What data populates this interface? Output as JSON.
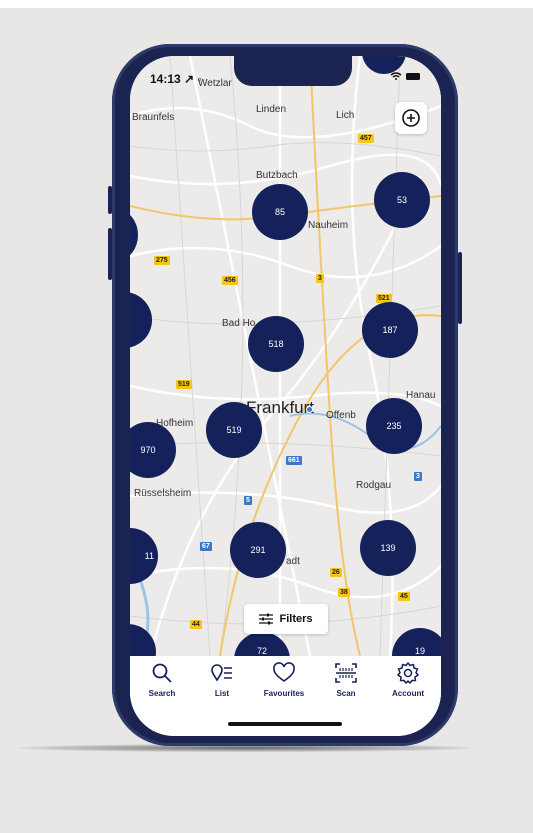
{
  "status": {
    "time": "14:13",
    "nav_glyph": "↗",
    "signal_glyph": "◦",
    "icons_text": "📶 ▬"
  },
  "map": {
    "labels": {
      "wetzlar": "Wetzlar",
      "braunfels": "Braunfels",
      "linden": "Linden",
      "lich": "Lich",
      "butzbach": "Butzbach",
      "nauheim": "Nauheim",
      "bad_homburg": "Bad Ho",
      "frankfurt": "Frankfurt",
      "offenbach": "Offenb",
      "hanau": "Hanau",
      "hofheim": "Hofheim",
      "ruesselsheim": "Rüsselsheim",
      "rodgau": "Rodgau",
      "darmstadt": "adt"
    },
    "road_badges": {
      "b457": "457",
      "b275": "275",
      "b456": "456",
      "b3a": "3",
      "b521": "521",
      "b519": "519",
      "b661": "661",
      "b5": "5",
      "b3b": "3",
      "b67": "67",
      "b26": "26",
      "b38": "38",
      "b45": "45",
      "b44": "44"
    },
    "clusters": {
      "c85": "85",
      "c53": "53",
      "c518": "518",
      "c187": "187",
      "c519": "519",
      "c235": "235",
      "c970": "970",
      "c291": "291",
      "c139": "139",
      "c11": "11",
      "c72": "72",
      "c19": "19"
    }
  },
  "zoom_button_icon": "plus-circle-icon",
  "filters": {
    "label": "Filters",
    "icon": "sliders-icon"
  },
  "tabbar": {
    "items": [
      {
        "label": "Search",
        "icon": "search-icon"
      },
      {
        "label": "List",
        "icon": "list-pin-icon"
      },
      {
        "label": "Favourites",
        "icon": "heart-icon"
      },
      {
        "label": "Scan",
        "icon": "scan-icon"
      },
      {
        "label": "Account",
        "icon": "gear-icon"
      }
    ]
  },
  "colors": {
    "accent": "#14215a",
    "phone_frame": "#1b2450",
    "map_bg": "#ecebe9",
    "road_badge": "#f5c518"
  }
}
